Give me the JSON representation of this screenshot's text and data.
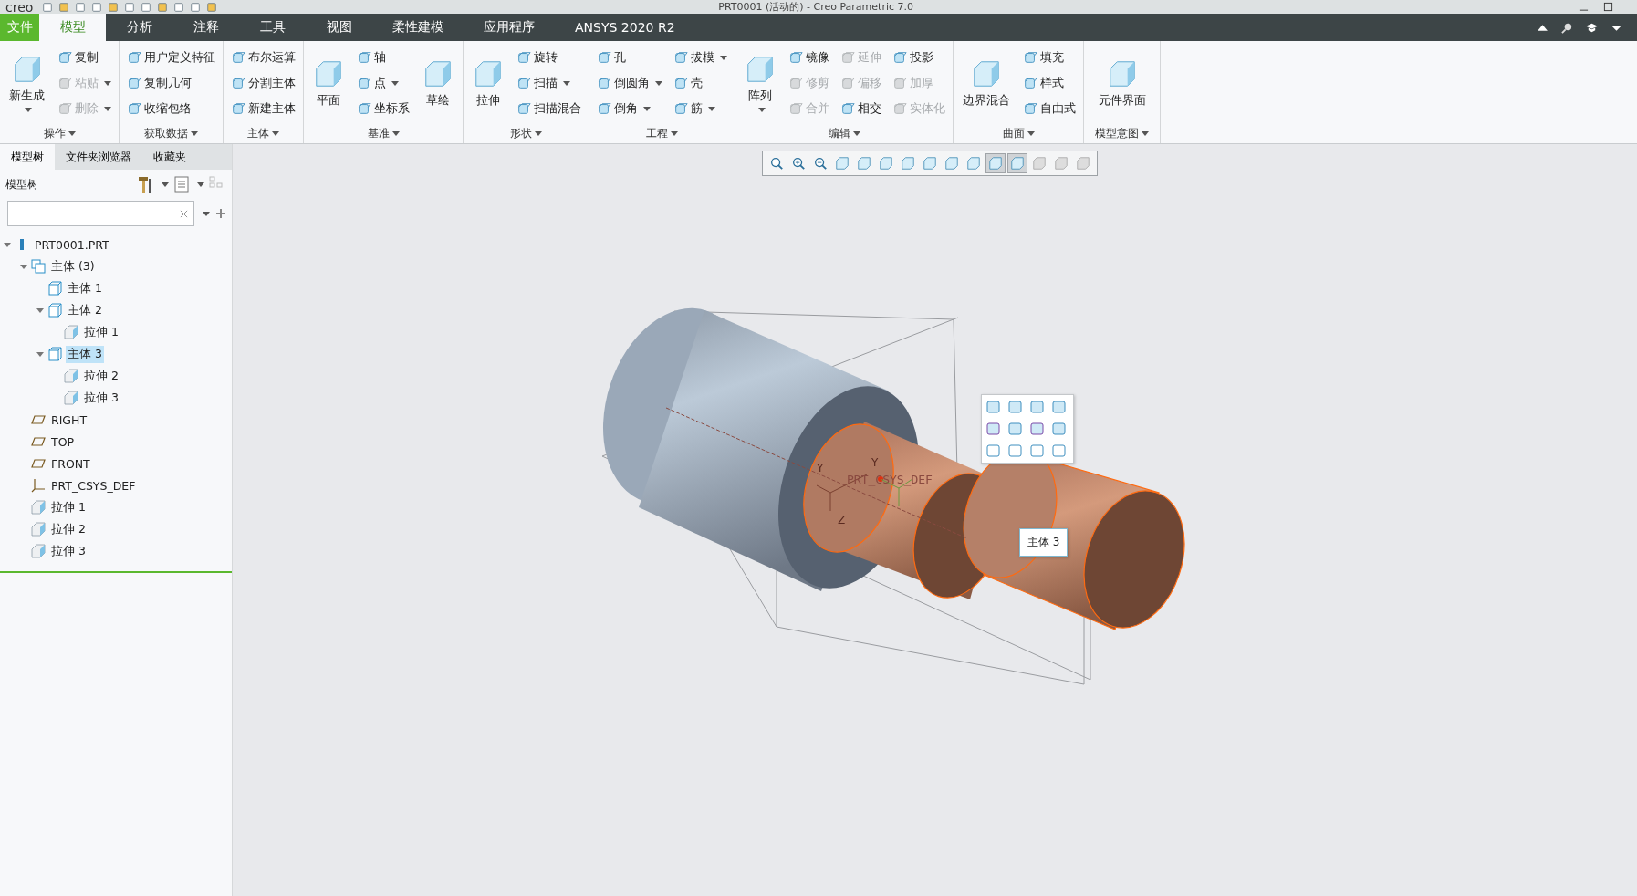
{
  "window": {
    "logo": "creo",
    "title": "PRT0001 (活动的) - Creo Parametric 7.0"
  },
  "tabs": [
    {
      "label": "文件",
      "kind": "file",
      "selected": false
    },
    {
      "label": "模型",
      "kind": "tab",
      "selected": true
    },
    {
      "label": "分析",
      "kind": "tab",
      "selected": false
    },
    {
      "label": "注释",
      "kind": "tab",
      "selected": false
    },
    {
      "label": "工具",
      "kind": "tab",
      "selected": false
    },
    {
      "label": "视图",
      "kind": "tab",
      "selected": false
    },
    {
      "label": "柔性建模",
      "kind": "tab",
      "selected": false
    },
    {
      "label": "应用程序",
      "kind": "tab",
      "selected": false
    },
    {
      "label": "ANSYS 2020 R2",
      "kind": "tab",
      "selected": false
    }
  ],
  "ribbon_groups": [
    {
      "label": "操作",
      "items": [
        {
          "label": "新生成",
          "kind": "large",
          "disabled": false,
          "dropdown": true
        },
        {
          "label": "复制",
          "kind": "small",
          "disabled": false,
          "dropdown": false
        },
        {
          "label": "粘贴",
          "kind": "small",
          "disabled": true,
          "dropdown": true
        },
        {
          "label": "删除",
          "kind": "small",
          "disabled": true,
          "dropdown": true
        }
      ]
    },
    {
      "label": "获取数据",
      "items": [
        {
          "label": "用户定义特征",
          "kind": "small",
          "disabled": false,
          "dropdown": false
        },
        {
          "label": "复制几何",
          "kind": "small",
          "disabled": false,
          "dropdown": false
        },
        {
          "label": "收缩包络",
          "kind": "small",
          "disabled": false,
          "dropdown": false
        }
      ]
    },
    {
      "label": "主体",
      "items": [
        {
          "label": "布尔运算",
          "kind": "small",
          "disabled": false,
          "dropdown": false
        },
        {
          "label": "分割主体",
          "kind": "small",
          "disabled": false,
          "dropdown": false
        },
        {
          "label": "新建主体",
          "kind": "small",
          "disabled": false,
          "dropdown": false
        }
      ]
    },
    {
      "label": "基准",
      "items": [
        {
          "label": "平面",
          "kind": "large",
          "disabled": false,
          "dropdown": false
        },
        {
          "label": "轴",
          "kind": "small",
          "disabled": false,
          "dropdown": false
        },
        {
          "label": "点",
          "kind": "small",
          "disabled": false,
          "dropdown": true
        },
        {
          "label": "坐标系",
          "kind": "small",
          "disabled": false,
          "dropdown": false
        },
        {
          "label": "草绘",
          "kind": "large",
          "disabled": false,
          "dropdown": false
        }
      ]
    },
    {
      "label": "形状",
      "items": [
        {
          "label": "拉伸",
          "kind": "large",
          "disabled": false,
          "dropdown": false
        },
        {
          "label": "旋转",
          "kind": "small",
          "disabled": false,
          "dropdown": false
        },
        {
          "label": "扫描",
          "kind": "small",
          "disabled": false,
          "dropdown": true
        },
        {
          "label": "扫描混合",
          "kind": "small",
          "disabled": false,
          "dropdown": false
        }
      ]
    },
    {
      "label": "工程",
      "items": [
        {
          "label": "孔",
          "kind": "small",
          "disabled": false,
          "dropdown": false
        },
        {
          "label": "倒圆角",
          "kind": "small",
          "disabled": false,
          "dropdown": true
        },
        {
          "label": "倒角",
          "kind": "small",
          "disabled": false,
          "dropdown": true
        },
        {
          "label": "拔模",
          "kind": "small",
          "disabled": false,
          "dropdown": true
        },
        {
          "label": "壳",
          "kind": "small",
          "disabled": false,
          "dropdown": false
        },
        {
          "label": "筋",
          "kind": "small",
          "disabled": false,
          "dropdown": true
        }
      ]
    },
    {
      "label": "编辑",
      "items": [
        {
          "label": "阵列",
          "kind": "large",
          "disabled": false,
          "dropdown": true
        },
        {
          "label": "镜像",
          "kind": "small",
          "disabled": false,
          "dropdown": false
        },
        {
          "label": "修剪",
          "kind": "small",
          "disabled": true,
          "dropdown": false
        },
        {
          "label": "合并",
          "kind": "small",
          "disabled": true,
          "dropdown": false
        },
        {
          "label": "延伸",
          "kind": "small",
          "disabled": true,
          "dropdown": false
        },
        {
          "label": "偏移",
          "kind": "small",
          "disabled": true,
          "dropdown": false
        },
        {
          "label": "相交",
          "kind": "small",
          "disabled": false,
          "dropdown": false
        },
        {
          "label": "投影",
          "kind": "small",
          "disabled": false,
          "dropdown": false
        },
        {
          "label": "加厚",
          "kind": "small",
          "disabled": true,
          "dropdown": false
        },
        {
          "label": "实体化",
          "kind": "small",
          "disabled": true,
          "dropdown": false
        }
      ]
    },
    {
      "label": "曲面",
      "items": [
        {
          "label": "边界混合",
          "kind": "large",
          "disabled": false,
          "dropdown": false
        },
        {
          "label": "填充",
          "kind": "small",
          "disabled": false,
          "dropdown": false
        },
        {
          "label": "样式",
          "kind": "small",
          "disabled": false,
          "dropdown": false
        },
        {
          "label": "自由式",
          "kind": "small",
          "disabled": false,
          "dropdown": false
        }
      ]
    },
    {
      "label": "模型意图",
      "items": [
        {
          "label": "元件界面",
          "kind": "large",
          "disabled": false,
          "dropdown": false
        }
      ]
    }
  ],
  "panel_tabs": [
    {
      "label": "模型树",
      "selected": true
    },
    {
      "label": "文件夹浏览器",
      "selected": false
    },
    {
      "label": "收藏夹",
      "selected": false
    }
  ],
  "panel_title": "模型树",
  "tree": [
    {
      "label": "PRT0001.PRT",
      "kind": "part",
      "selected": false,
      "expanded": true,
      "children": [
        {
          "label": "主体 (3)",
          "kind": "bodies",
          "selected": false,
          "expanded": true,
          "children": [
            {
              "label": "主体 1",
              "kind": "body",
              "selected": false
            },
            {
              "label": "主体 2",
              "kind": "body",
              "selected": false,
              "expanded": true,
              "children": [
                {
                  "label": "拉伸 1",
                  "kind": "extrude",
                  "selected": false
                }
              ]
            },
            {
              "label": "主体 3",
              "kind": "body",
              "selected": true,
              "expanded": true,
              "children": [
                {
                  "label": "拉伸 2",
                  "kind": "extrude",
                  "selected": false
                },
                {
                  "label": "拉伸 3",
                  "kind": "extrude",
                  "selected": false
                }
              ]
            }
          ]
        },
        {
          "label": "RIGHT",
          "kind": "plane",
          "selected": false
        },
        {
          "label": "TOP",
          "kind": "plane",
          "selected": false
        },
        {
          "label": "FRONT",
          "kind": "plane",
          "selected": false
        },
        {
          "label": "PRT_CSYS_DEF",
          "kind": "csys",
          "selected": false
        },
        {
          "label": "拉伸 1",
          "kind": "extrude",
          "selected": false
        },
        {
          "label": "拉伸 2",
          "kind": "extrude",
          "selected": false
        },
        {
          "label": "拉伸 3",
          "kind": "extrude",
          "selected": false
        }
      ]
    }
  ],
  "view_toolbar": [
    {
      "on": false
    },
    {
      "on": false
    },
    {
      "on": false
    },
    {
      "on": false
    },
    {
      "on": false
    },
    {
      "on": false
    },
    {
      "on": false
    },
    {
      "on": false
    },
    {
      "on": false
    },
    {
      "on": false
    },
    {
      "on": true
    },
    {
      "on": true
    },
    {
      "on": false
    },
    {
      "on": false
    },
    {
      "on": false
    }
  ],
  "model": {
    "axis_labels": [
      "Y",
      "Y",
      "Z"
    ],
    "csys_label": "PRT_CSYS_DEF"
  },
  "tooltip": "主体 3"
}
